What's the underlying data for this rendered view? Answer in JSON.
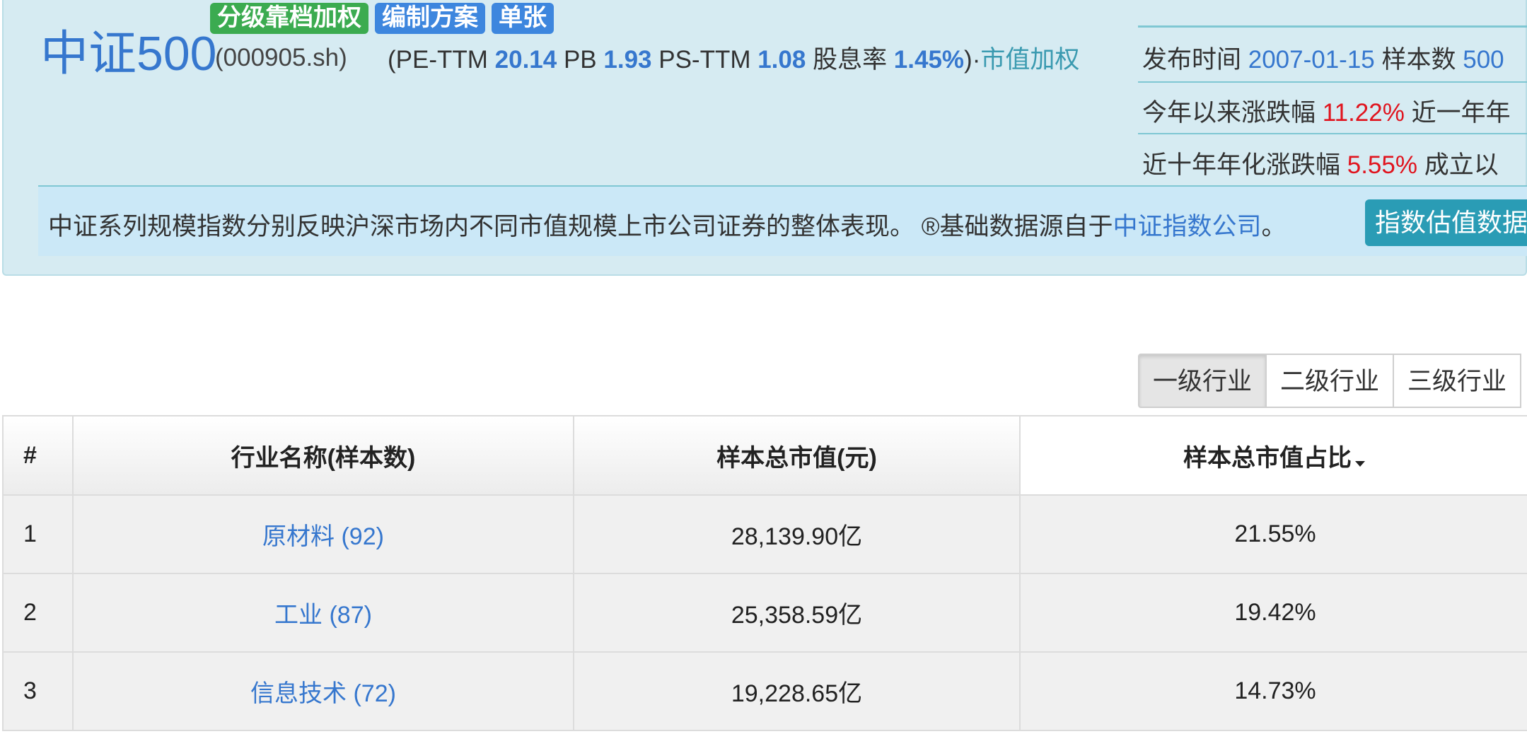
{
  "header": {
    "badges": [
      "分级靠档加权",
      "编制方案",
      "单张"
    ],
    "title": "中证500",
    "code": "(000905.sh)",
    "metrics": {
      "open": "(PE-TTM ",
      "pe_ttm": "20.14",
      "pb_label": "  PB ",
      "pb": "1.93",
      "ps_label": "  PS-TTM ",
      "ps_ttm": "1.08",
      "div_label": "  股息率 ",
      "dividend_yield": "1.45%",
      "close": ")·",
      "weighting": "市值加权"
    },
    "info": {
      "publish_label": "发布时间 ",
      "publish_date": "2007-01-15",
      "samples_label": "   样本数 ",
      "samples": "500",
      "ytd_label": "今年以来涨跌幅 ",
      "ytd": "11.22%",
      "one_year_label": "   近一年年",
      "ten_year_label": "近十年年化涨跌幅 ",
      "ten_year": "5.55%",
      "since_label": "   成立以"
    },
    "description": "中证系列规模指数分别反映沪深市场内不同市值规模上市公司证券的整体表现。 ®基础数据源自于",
    "source_link": "中证指数公司",
    "source_end": "。",
    "calc_button": "指数估值数据计算"
  },
  "tabs": [
    "一级行业",
    "二级行业",
    "三级行业"
  ],
  "table": {
    "columns": [
      "#",
      "行业名称(样本数)",
      "样本总市值(元)",
      "样本总市值占比"
    ],
    "rows": [
      {
        "num": "1",
        "name": "原材料 (92)",
        "mcap": "28,139.90亿",
        "pct": "21.55%"
      },
      {
        "num": "2",
        "name": "工业 (87)",
        "mcap": "25,358.59亿",
        "pct": "19.42%"
      },
      {
        "num": "3",
        "name": "信息技术 (72)",
        "mcap": "19,228.65亿",
        "pct": "14.73%"
      }
    ]
  },
  "colors": {
    "accent_blue": "#3677ce",
    "badge_green": "#3bab50",
    "negative_red": "#e0141e",
    "panel_bg": "#d6ebf2"
  }
}
